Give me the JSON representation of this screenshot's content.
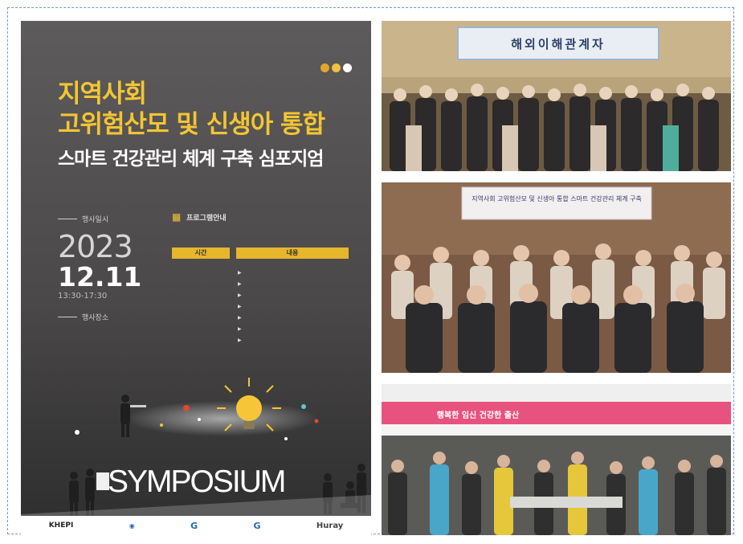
{
  "poster": {
    "title_line1": "지역사회",
    "title_line2": "고위험산모 및 신생아 통합",
    "subtitle": "스마트 건강관리 체계 구축 심포지엄",
    "date_label": "행사일시",
    "year": "2023",
    "date": "12.11",
    "time": "13:30-17:30",
    "venue_label": "행사장소",
    "venue_line1": "",
    "venue_line2": "",
    "program_title": "프로그램안내",
    "program_desc": "",
    "col_time": "시간",
    "col_content": "내용",
    "rows": [
      {
        "time": "",
        "content": ""
      },
      {
        "time": "",
        "content": ""
      },
      {
        "time": "",
        "content": ""
      },
      {
        "time": "",
        "content": ""
      },
      {
        "time": "",
        "content": ""
      },
      {
        "time": "",
        "content": ""
      },
      {
        "time": "",
        "content": ""
      }
    ],
    "symposium": "SYMPOSIUM",
    "footer_logos": [
      "KHEPI",
      "",
      "G",
      "G",
      "Huray"
    ],
    "colors": {
      "accent": "#f3c534",
      "dots": [
        "#e6a52a",
        "#f0c240",
        "#ffffff"
      ]
    }
  },
  "photos": [
    {
      "banner_text": "해외이해관계자",
      "description_icon": "group-photo-indoor"
    },
    {
      "banner_text": "지역사회 고위험산모 및 신생아 통합 스마트 건강관리 체계 구축",
      "description_icon": "group-photo-seated"
    },
    {
      "banner_text": "행복한 임신 건강한 출산",
      "description_icon": "outdoor-event-tent"
    }
  ]
}
